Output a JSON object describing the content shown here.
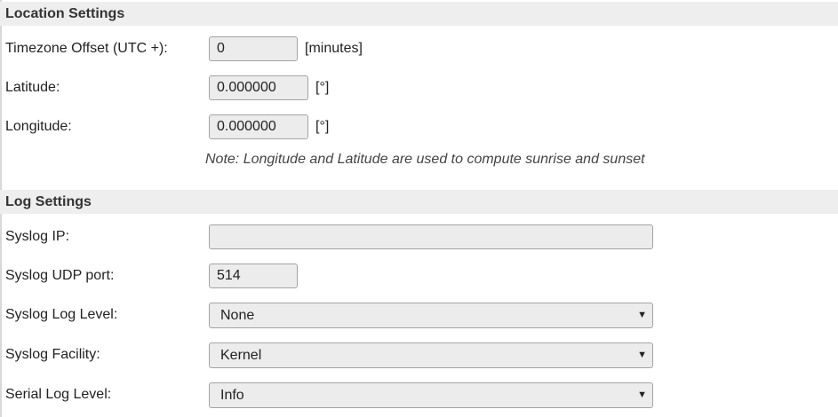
{
  "location": {
    "header": "Location Settings",
    "timezone": {
      "label": "Timezone Offset (UTC +):",
      "value": "0",
      "unit": "[minutes]"
    },
    "latitude": {
      "label": "Latitude:",
      "value": "0.000000",
      "unit": "[°]"
    },
    "longitude": {
      "label": "Longitude:",
      "value": "0.000000",
      "unit": "[°]"
    },
    "note": "Note: Longitude and Latitude are used to compute sunrise and sunset"
  },
  "log": {
    "header": "Log Settings",
    "syslog_ip": {
      "label": "Syslog IP:",
      "value": ""
    },
    "syslog_udp_port": {
      "label": "Syslog UDP port:",
      "value": "514"
    },
    "syslog_log_level": {
      "label": "Syslog Log Level:",
      "selected": "None"
    },
    "syslog_facility": {
      "label": "Syslog Facility:",
      "selected": "Kernel"
    },
    "serial_log_level": {
      "label": "Serial Log Level:",
      "selected": "Info"
    }
  },
  "icons": {
    "dropdown_arrow": "▼"
  }
}
